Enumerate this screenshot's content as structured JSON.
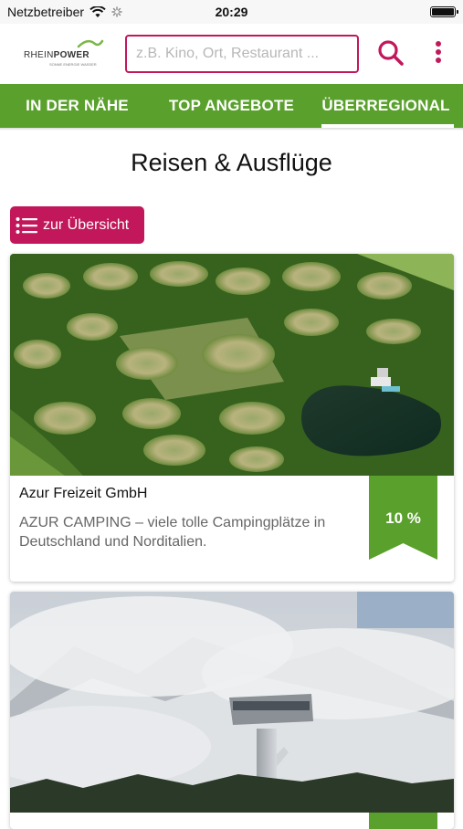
{
  "status_bar": {
    "carrier": "Netzbetreiber",
    "time": "20:29",
    "battery_level": 0.95
  },
  "header": {
    "logo_text_part1": "RHEIN",
    "logo_text_part2": "POWER",
    "logo_subtitle": "SONNE ENERGIE WASSER",
    "search_placeholder": "z.B. Kino, Ort, Restaurant ...",
    "search_icon": "search-icon",
    "menu_icon": "more-vertical-icon"
  },
  "tabs": [
    {
      "label": "IN DER NÄHE",
      "active": false
    },
    {
      "label": "TOP ANGEBOTE",
      "active": false
    },
    {
      "label": "ÜBERREGIONAL",
      "active": true
    }
  ],
  "page": {
    "title": "Reisen & Ausflüge",
    "overview_button": "zur Übersicht",
    "overview_icon": "list-icon"
  },
  "cards": [
    {
      "name": "Azur Freizeit GmbH",
      "description": "AZUR CAMPING – viele tolle Campingplätze in Deutschland und Norditalien.",
      "discount": "10 %",
      "image": "aerial-campground-photo"
    },
    {
      "name": "",
      "description": "",
      "discount": "",
      "image": "ski-jump-tower-mountain-photo"
    }
  ],
  "colors": {
    "brand_green": "#5aa02c",
    "brand_magenta": "#c2185b"
  }
}
